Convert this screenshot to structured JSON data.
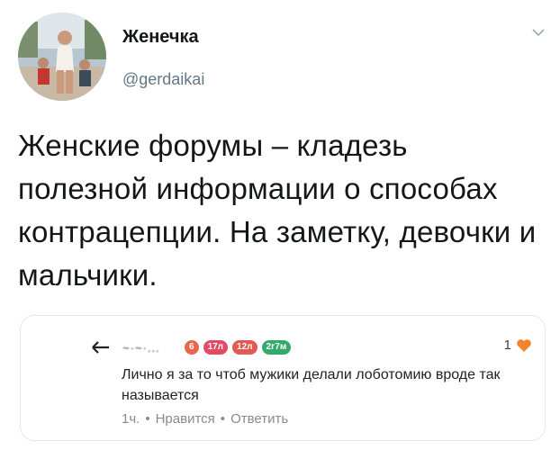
{
  "user": {
    "display_name": "Женечка",
    "handle": "@gerdaikai"
  },
  "tweet": {
    "text": "Женские форумы – кладезь полезной информации о способах контрацепции. На заметку, девочки и мальчики."
  },
  "embedded_comment": {
    "author": "~·~·...",
    "badges": [
      "6",
      "17л",
      "12л",
      "2г7м"
    ],
    "badge_colors": [
      "#e8664c",
      "#e14b65",
      "#e25a52",
      "#35a96a"
    ],
    "like_count": "1",
    "text": "Лично я за то чтоб мужики делали лоботомию вроде так называется",
    "time": "1ч.",
    "separator": "•",
    "like_action": "Нравится",
    "reply_action": "Ответить"
  },
  "icons": {
    "menu": "chevron-down-icon",
    "back": "back-arrow-icon",
    "like": "heart-icon"
  },
  "colors": {
    "heart": "#f5832c",
    "handle": "#657786",
    "border": "#e1e8ed"
  }
}
